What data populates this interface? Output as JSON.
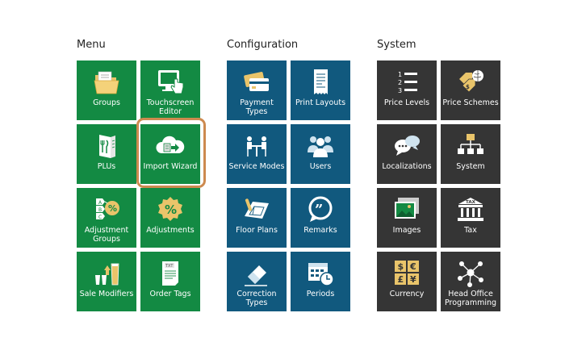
{
  "colors": {
    "menu": "#138a43",
    "configuration": "#11597e",
    "system": "#353535",
    "highlight": "#cd8a4f"
  },
  "sections": [
    {
      "title": "Menu",
      "tiles": [
        {
          "label": "Groups",
          "icon": "folder-icon"
        },
        {
          "label": "Touchscreen Editor",
          "icon": "touchscreen-icon"
        },
        {
          "label": "PLUs",
          "icon": "menu-book-icon"
        },
        {
          "label": "Import Wizard",
          "icon": "cloud-import-icon",
          "highlighted": true
        },
        {
          "label": "Adjustment Groups",
          "icon": "tiered-percent-icon"
        },
        {
          "label": "Adjustments",
          "icon": "percent-badge-icon"
        },
        {
          "label": "Sale Modifiers",
          "icon": "glasses-arrow-icon"
        },
        {
          "label": "Order Tags",
          "icon": "txt-document-icon"
        }
      ]
    },
    {
      "title": "Configuration",
      "tiles": [
        {
          "label": "Payment Types",
          "icon": "credit-cards-icon"
        },
        {
          "label": "Print Layouts",
          "icon": "receipt-icon"
        },
        {
          "label": "Service Modes",
          "icon": "dining-table-icon"
        },
        {
          "label": "Users",
          "icon": "users-icon"
        },
        {
          "label": "Floor Plans",
          "icon": "floor-plan-icon"
        },
        {
          "label": "Remarks",
          "icon": "quote-bubble-icon"
        },
        {
          "label": "Correction Types",
          "icon": "eraser-icon"
        },
        {
          "label": "Periods",
          "icon": "calendar-clock-icon"
        }
      ]
    },
    {
      "title": "System",
      "tiles": [
        {
          "label": "Price Levels",
          "icon": "numbered-list-icon"
        },
        {
          "label": "Price Schemes",
          "icon": "price-tags-globe-icon"
        },
        {
          "label": "Localizations",
          "icon": "chat-bubbles-icon"
        },
        {
          "label": "System",
          "icon": "hierarchy-icon"
        },
        {
          "label": "Images",
          "icon": "images-icon"
        },
        {
          "label": "Tax",
          "icon": "tax-building-icon"
        },
        {
          "label": "Currency",
          "icon": "currency-icon"
        },
        {
          "label": "Head Office Programming",
          "icon": "network-icon"
        }
      ]
    }
  ],
  "icon_text": {
    "tax": "TAX",
    "txt": "TXT",
    "level1": "1",
    "level2": "2",
    "level3": "3",
    "dollar": "$",
    "euro": "€",
    "pound": "£",
    "yen": "¥",
    "tierA": "A",
    "tierB": "B",
    "tierC": "C"
  }
}
